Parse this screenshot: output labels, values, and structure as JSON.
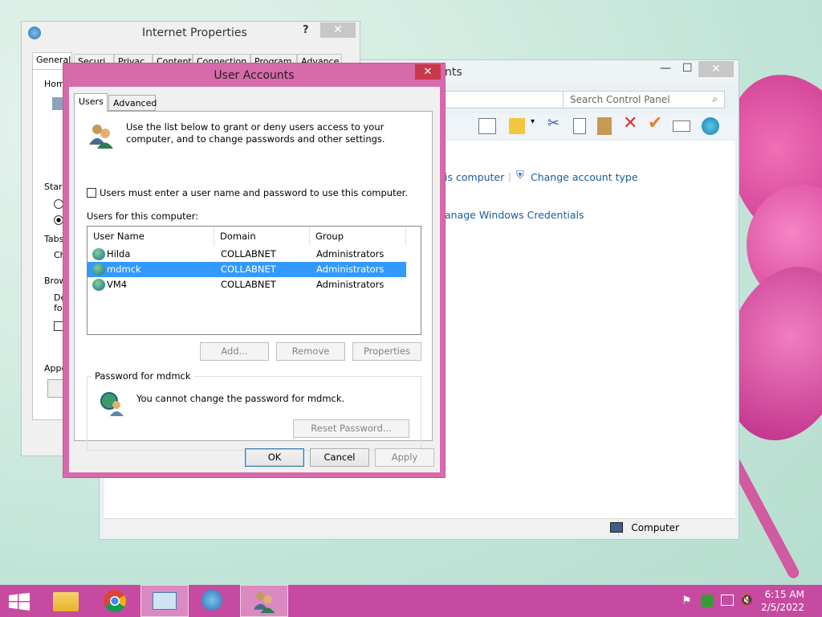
{
  "control_panel": {
    "title_fragment": "nts",
    "search_placeholder": "Search Control Panel",
    "links": {
      "this_computer": "is computer",
      "change_account_type": "Change account type",
      "manage_credentials": "anage Windows Credentials"
    },
    "status": "Computer"
  },
  "internet_properties": {
    "title": "Internet Properties",
    "help": "?",
    "close": "✕",
    "tabs": [
      "General",
      "Securi",
      "Privac",
      "Content",
      "Connection",
      "Program",
      "Advance"
    ],
    "fragments": {
      "home": "Home",
      "start": "Star",
      "tabs": "Tabs",
      "ch": "Ch",
      "brow": "Brow",
      "de": "De",
      "fo": "fo",
      "appe": "Appe"
    }
  },
  "user_accounts": {
    "title": "User Accounts",
    "close": "✕",
    "tabs": {
      "users": "Users",
      "advanced": "Advanced"
    },
    "intro": "Use the list below to grant or deny users access to your computer, and to change passwords and other settings.",
    "must_enter_label": "Users must enter a user name and password to use this computer.",
    "users_for_label": "Users for this computer:",
    "columns": {
      "name": "User Name",
      "domain": "Domain",
      "group": "Group"
    },
    "users": [
      {
        "name": "Hilda",
        "domain": "COLLABNET",
        "group": "Administrators"
      },
      {
        "name": "mdmck",
        "domain": "COLLABNET",
        "group": "Administrators"
      },
      {
        "name": "VM4",
        "domain": "COLLABNET",
        "group": "Administrators"
      }
    ],
    "buttons": {
      "add": "Add...",
      "remove": "Remove",
      "properties": "Properties"
    },
    "password_group": {
      "legend": "Password for mdmck",
      "message": "You cannot change the password for mdmck.",
      "reset": "Reset Password..."
    },
    "footer": {
      "ok": "OK",
      "cancel": "Cancel",
      "apply": "Apply"
    }
  },
  "taskbar": {
    "time": "6:15 AM",
    "date": "2/5/2022"
  }
}
